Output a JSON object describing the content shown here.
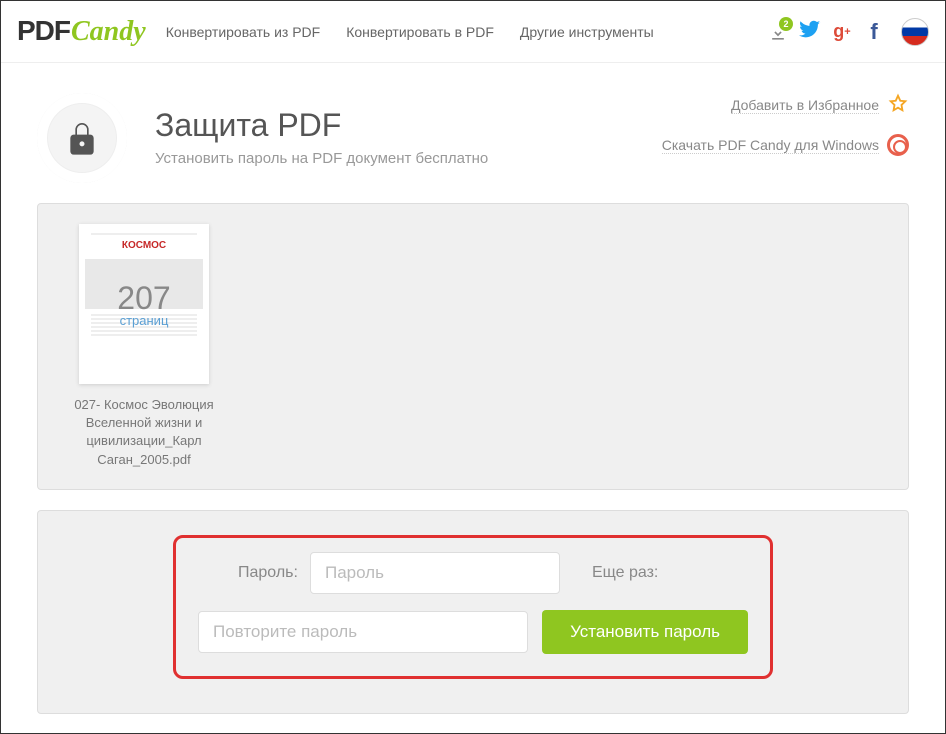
{
  "header": {
    "logo_pdf": "PDF",
    "logo_candy": "Candy",
    "nav": [
      "Конвертировать из PDF",
      "Конвертировать в PDF",
      "Другие инструменты"
    ],
    "download_badge": "2"
  },
  "top_actions": {
    "favorite": "Добавить в Избранное",
    "download_win": "Скачать PDF Candy для Windows"
  },
  "tool": {
    "title": "Защита PDF",
    "subtitle": "Установить пароль на PDF документ бесплатно"
  },
  "file": {
    "thumb_title": "КОСМОС",
    "page_count": "207",
    "page_label": "страниц",
    "name": "027- Космос Эволюция Вселенной жизни и цивилизации_Карл Саган_2005.pdf"
  },
  "password_form": {
    "label_password": "Пароль:",
    "placeholder_password": "Пароль",
    "label_repeat": "Еще раз:",
    "placeholder_repeat": "Повторите пароль",
    "submit": "Установить пароль"
  }
}
